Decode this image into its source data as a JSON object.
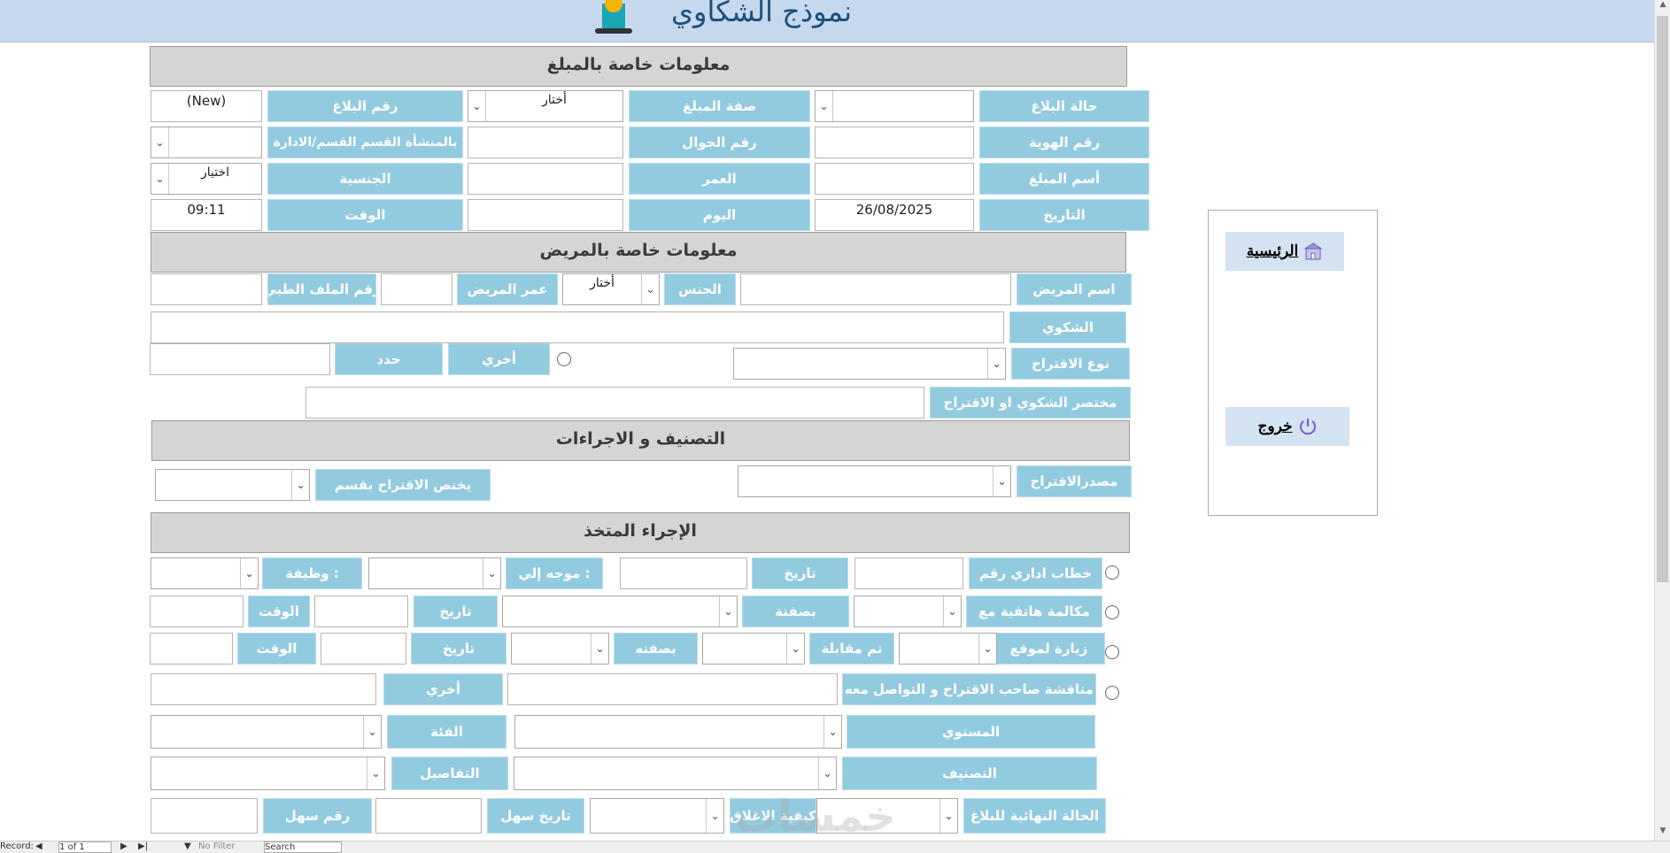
{
  "app": {
    "title": "نموذج الشكاوي"
  },
  "sections": {
    "reporter": "معلومات خاصة بالمبلغ",
    "patient": "معلومات خاصة بالمريض",
    "classification": "التصنيف و الاجراءات",
    "action": "الإجراء المتخذ"
  },
  "reporter": {
    "status_label": "حالة البلاغ",
    "status_value": "",
    "capacity_label": "صفة المبلغ",
    "capacity_value": "أختار",
    "number_label": "رقم البلاغ",
    "number_value": "(New)",
    "id_label": "رقم الهوية",
    "mobile_label": "رقم الجوال",
    "facility_label": "بالمنشأة القسم القسم/الادارة",
    "name_label": "أسم المبلغ",
    "age_label": "العمر",
    "nationality_label": "الجنسية",
    "nationality_value": "اختيار",
    "date_label": "التاريخ",
    "date_value": "26/08/2025",
    "day_label": "اليوم",
    "time_label": "الوقت",
    "time_value": "09:11"
  },
  "patient": {
    "name_label": "اسم المريض",
    "gender_label": "الجنس",
    "gender_value": "أختار",
    "age_label": "عمر المريض",
    "file_label": "رقم الملف الطبي",
    "complaint_label": "الشكوي",
    "suggestion_type_label": "نوع الاقتراح",
    "other_label": "أخري",
    "specify_label": "حدد",
    "summary_label": "مختصر الشكوي او الاقتراح"
  },
  "classification": {
    "source_label": "مصدرالاقتراح",
    "dept_label": "يخنص الاقتراح بقسم"
  },
  "action": {
    "letter_label": "خطاب اداري رقم",
    "letter_date_label": "تاريخ",
    "directed_label": "موجه إلي :",
    "job_label": "وظيفة :",
    "call_label": "مكالمة هاتفية مع",
    "call_as_label": "بصفتة",
    "call_date_label": "تاريخ",
    "call_time_label": "الوقت",
    "visit_label": "زيارة لموقع",
    "met_label": "تم مقابلة",
    "visit_as_label": "بصفته",
    "visit_date_label": "تاريخ",
    "visit_time_label": "الوقت",
    "discuss_label": "مناقشة صاحب الاقتراح و التواصل معه",
    "discuss_other_label": "أخري",
    "level_label": "المستوي",
    "category_label": "الفئة",
    "classify_label": "التصنيف",
    "details_label": "التفاصيل",
    "final_status_label": "الحالة النهائية للبلاغ",
    "closing_label": "كيفية الاغلاق",
    "sahl_date_label": "تاريخ سهل",
    "sahl_number_label": "رقم سهل"
  },
  "nav": {
    "home_label": "الرئيسية",
    "exit_label": "خروج"
  },
  "status": {
    "record_label": "Record:",
    "record_value": "1 of 1",
    "filter_label": "No Filter",
    "search_label": "Search"
  },
  "watermark": "خمسات",
  "colors": {
    "label_bg": "#92cbdf",
    "section_bg": "#d5d5d5",
    "titlebar_bg": "#c5d8ee"
  }
}
